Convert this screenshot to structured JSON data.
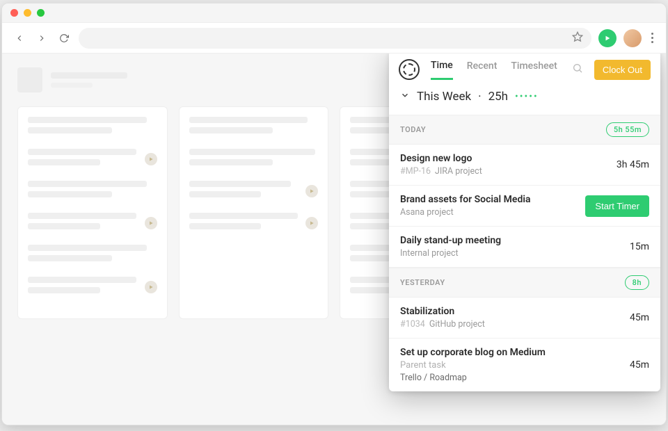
{
  "panel": {
    "tabs": {
      "time": "Time",
      "recent": "Recent",
      "timesheet": "Timesheet"
    },
    "clock_out": "Clock Out",
    "week_label": "This Week",
    "week_hours": "25h",
    "activity_dots": "•••••",
    "sections": [
      {
        "title": "TODAY",
        "badge": "5h 55m",
        "entries": [
          {
            "title": "Design new logo",
            "ref": "#MP-16",
            "project": "JIRA project",
            "time": "3h 45m"
          },
          {
            "title": "Brand assets for Social Media",
            "project": "Asana project",
            "action": "Start Timer"
          },
          {
            "title": "Daily stand-up meeting",
            "project": "Internal project",
            "time": "15m"
          }
        ]
      },
      {
        "title": "YESTERDAY",
        "badge": "8h",
        "entries": [
          {
            "title": "Stabilization",
            "ref": "#1034",
            "project": "GitHub project",
            "time": "45m"
          },
          {
            "title": "Set up corporate blog on Medium",
            "parent": "Parent task",
            "project": "Trello / Roadmap",
            "time": "45m"
          }
        ]
      }
    ]
  }
}
